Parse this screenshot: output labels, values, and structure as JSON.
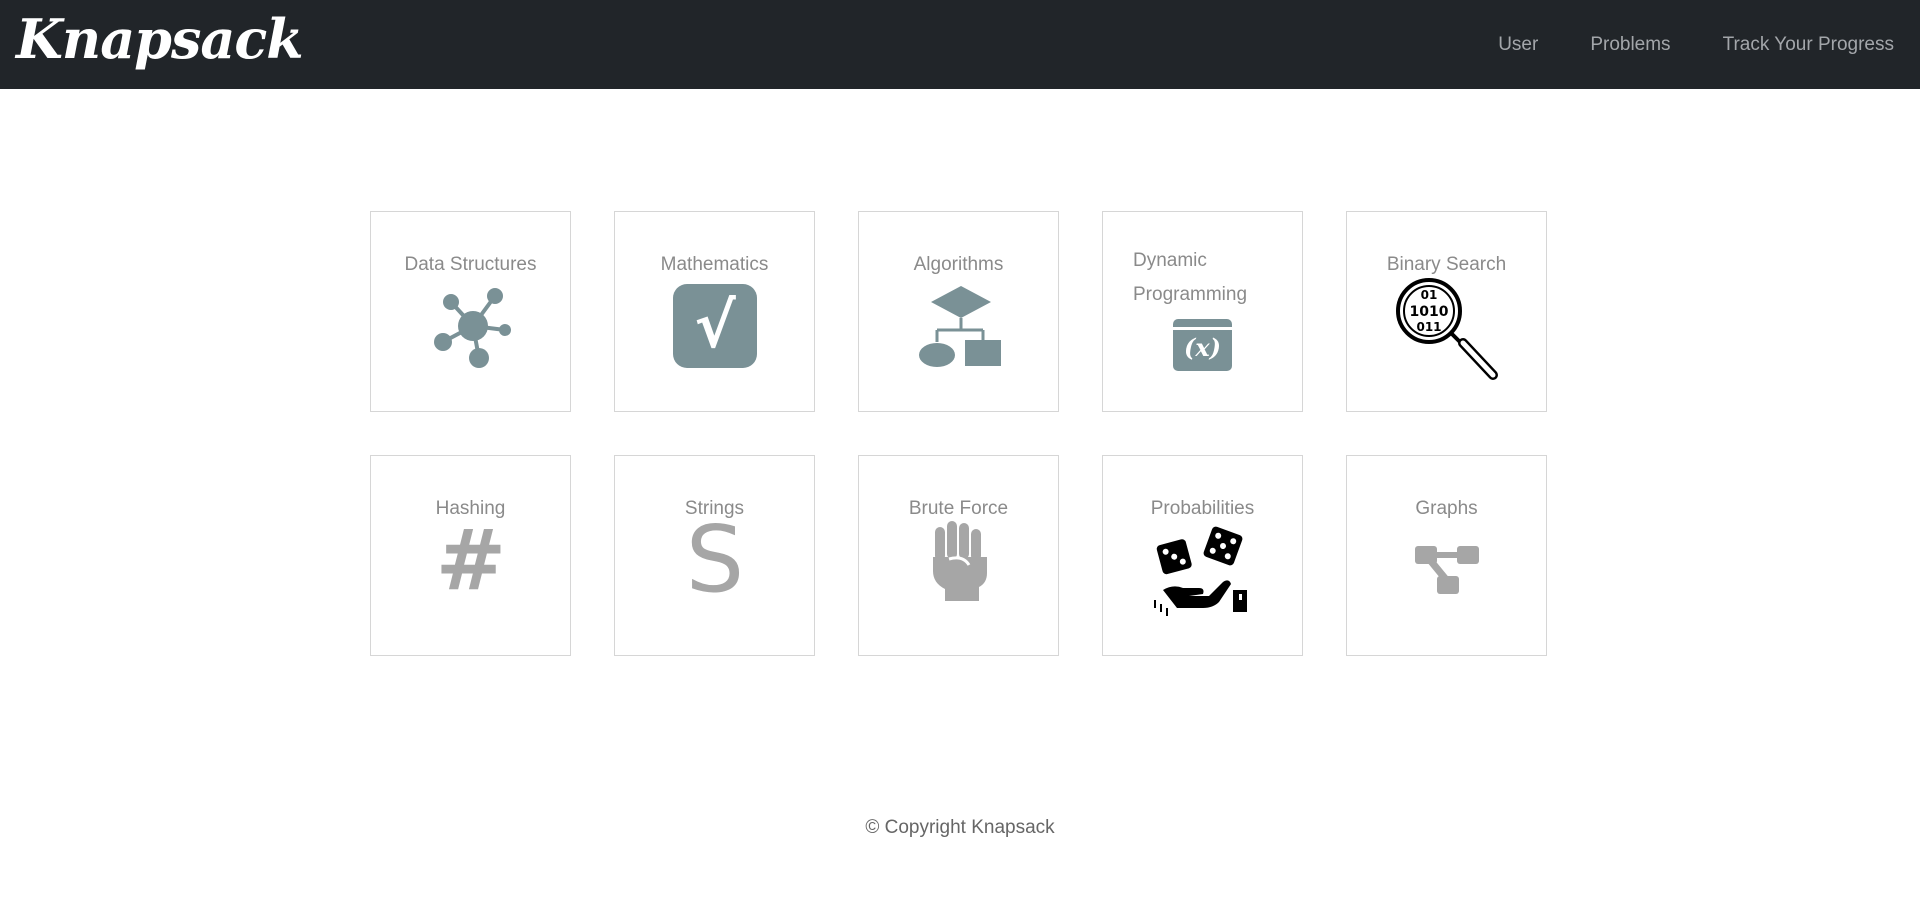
{
  "navbar": {
    "brand": "Knapsack",
    "links": [
      "User",
      "Problems",
      "Track Your Progress"
    ]
  },
  "cards": [
    {
      "title": "Data Structures",
      "icon": "network-nodes-icon"
    },
    {
      "title": "Mathematics",
      "icon": "square-root-icon"
    },
    {
      "title": "Algorithms",
      "icon": "flowchart-icon"
    },
    {
      "title": "Dynamic Programming",
      "icon": "function-x-icon"
    },
    {
      "title": "Binary Search",
      "icon": "binary-magnifier-icon"
    },
    {
      "title": "Hashing",
      "icon": "hash-icon"
    },
    {
      "title": "Strings",
      "icon": "letter-s-icon"
    },
    {
      "title": "Brute Force",
      "icon": "fist-icon"
    },
    {
      "title": "Probabilities",
      "icon": "dice-hand-icon"
    },
    {
      "title": "Graphs",
      "icon": "tree-graph-icon"
    }
  ],
  "colors": {
    "navbar_bg": "#212529",
    "icon_slate": "#7a9196",
    "icon_gray": "#a6a6a6"
  },
  "icon_glyphs": {
    "sqrt": "√",
    "fx": "(x)",
    "binary_top": "01",
    "binary_mid": "1010",
    "binary_bot": "011",
    "hash": "#",
    "s": "S"
  },
  "footer": {
    "copyright": "© Copyright Knapsack"
  }
}
